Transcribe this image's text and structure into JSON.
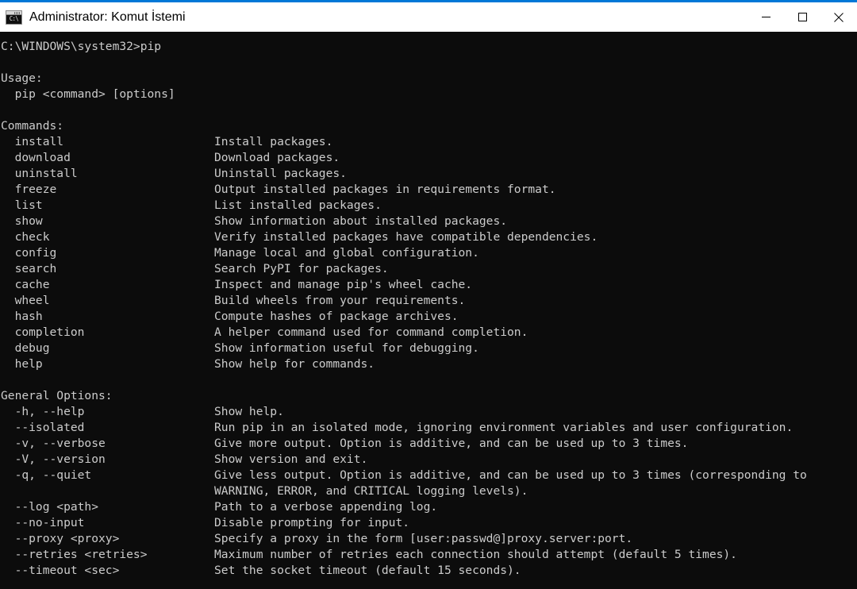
{
  "window": {
    "title": "Administrator: Komut İstemi",
    "icon": "cmd-icon",
    "icon_prompt_text": "C:\\",
    "accent_color": "#0078d7",
    "titlebar_color": "#ffffff",
    "terminal_bg": "#0c0c0c",
    "terminal_fg": "#cccccc"
  },
  "controls": {
    "minimize": "minimize-icon",
    "maximize": "maximize-icon",
    "close": "close-icon"
  },
  "terminal": {
    "prompt_line": "C:\\WINDOWS\\system32>pip",
    "usage_header": "Usage:",
    "usage_line": "  pip <command> [options]",
    "commands_header": "Commands:",
    "commands": [
      {
        "name": "  install",
        "desc": "Install packages."
      },
      {
        "name": "  download",
        "desc": "Download packages."
      },
      {
        "name": "  uninstall",
        "desc": "Uninstall packages."
      },
      {
        "name": "  freeze",
        "desc": "Output installed packages in requirements format."
      },
      {
        "name": "  list",
        "desc": "List installed packages."
      },
      {
        "name": "  show",
        "desc": "Show information about installed packages."
      },
      {
        "name": "  check",
        "desc": "Verify installed packages have compatible dependencies."
      },
      {
        "name": "  config",
        "desc": "Manage local and global configuration."
      },
      {
        "name": "  search",
        "desc": "Search PyPI for packages."
      },
      {
        "name": "  cache",
        "desc": "Inspect and manage pip's wheel cache."
      },
      {
        "name": "  wheel",
        "desc": "Build wheels from your requirements."
      },
      {
        "name": "  hash",
        "desc": "Compute hashes of package archives."
      },
      {
        "name": "  completion",
        "desc": "A helper command used for command completion."
      },
      {
        "name": "  debug",
        "desc": "Show information useful for debugging."
      },
      {
        "name": "  help",
        "desc": "Show help for commands."
      }
    ],
    "options_header": "General Options:",
    "options": [
      {
        "name": "  -h, --help",
        "desc": "Show help."
      },
      {
        "name": "  --isolated",
        "desc": "Run pip in an isolated mode, ignoring environment variables and user configuration."
      },
      {
        "name": "  -v, --verbose",
        "desc": "Give more output. Option is additive, and can be used up to 3 times."
      },
      {
        "name": "  -V, --version",
        "desc": "Show version and exit."
      },
      {
        "name": "  -q, --quiet",
        "desc": "Give less output. Option is additive, and can be used up to 3 times (corresponding to"
      },
      {
        "name": "",
        "desc": "WARNING, ERROR, and CRITICAL logging levels)."
      },
      {
        "name": "  --log <path>",
        "desc": "Path to a verbose appending log."
      },
      {
        "name": "  --no-input",
        "desc": "Disable prompting for input."
      },
      {
        "name": "  --proxy <proxy>",
        "desc": "Specify a proxy in the form [user:passwd@]proxy.server:port."
      },
      {
        "name": "  --retries <retries>",
        "desc": "Maximum number of retries each connection should attempt (default 5 times)."
      },
      {
        "name": "  --timeout <sec>",
        "desc": "Set the socket timeout (default 15 seconds)."
      }
    ]
  }
}
